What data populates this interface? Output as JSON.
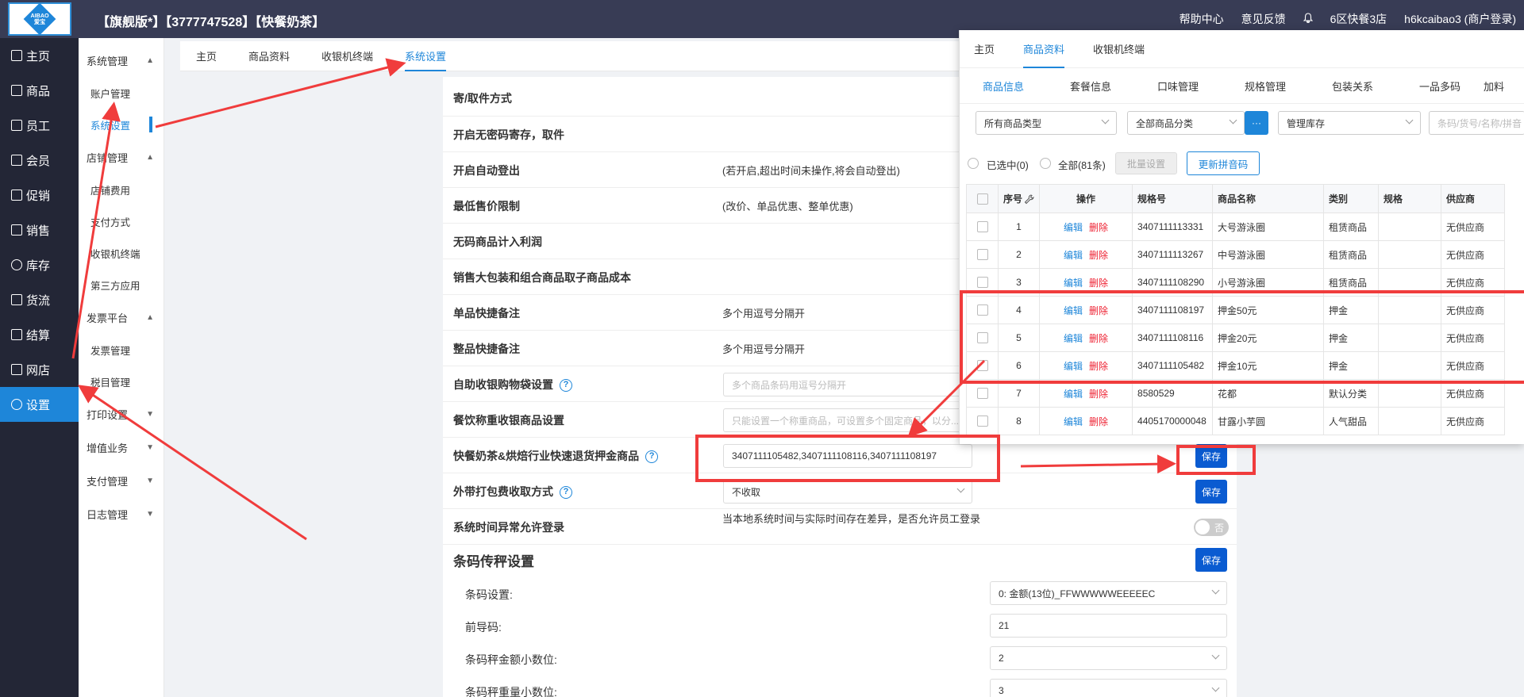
{
  "logo": {
    "text_top": "AIBAO",
    "text_bottom": "爱宝"
  },
  "header": {
    "title": "【旗舰版*】【3777747528】【快餐奶茶】",
    "help": "帮助中心",
    "feedback": "意见反馈",
    "store": "6区快餐3店",
    "user": "h6kcaibao3 (商户登录)"
  },
  "leftnav": {
    "items": [
      {
        "label": "主页",
        "icon": "home-icon"
      },
      {
        "label": "商品",
        "icon": "goods-icon"
      },
      {
        "label": "员工",
        "icon": "staff-icon"
      },
      {
        "label": "会员",
        "icon": "member-icon"
      },
      {
        "label": "促销",
        "icon": "promo-icon"
      },
      {
        "label": "销售",
        "icon": "sales-icon"
      },
      {
        "label": "库存",
        "icon": "inventory-icon"
      },
      {
        "label": "货流",
        "icon": "logistics-icon"
      },
      {
        "label": "结算",
        "icon": "settle-icon"
      },
      {
        "label": "网店",
        "icon": "shop-icon"
      },
      {
        "label": "设置",
        "icon": "gear-icon"
      }
    ]
  },
  "subnav": {
    "g1": "系统管理",
    "g1_items": [
      "账户管理",
      "系统设置"
    ],
    "g2": "店铺管理",
    "g2_items": [
      "店铺费用",
      "支付方式",
      "收银机终端",
      "第三方应用"
    ],
    "g3": "发票平台",
    "g3_items": [
      "发票管理",
      "税目管理"
    ],
    "g4": "打印设置",
    "g5": "增值业务",
    "g6": "支付管理",
    "g7": "日志管理"
  },
  "tabs": {
    "home": "主页",
    "goods": "商品资料",
    "pos": "收银机终端",
    "settings": "系统设置"
  },
  "settings": {
    "r1": "寄/取件方式",
    "r2": "开启无密码寄存，取件",
    "r3": "开启自动登出",
    "r3_desc": "(若开启,超出时间未操作,将会自动登出)",
    "r4": "最低售价限制",
    "r4_desc": "(改价、单品优惠、整单优惠)",
    "r5": "无码商品计入利润",
    "r6": "销售大包装和组合商品取子商品成本",
    "r7": "单品快捷备注",
    "r7_desc": "多个用逗号分隔开",
    "r8": "整品快捷备注",
    "r8_desc": "多个用逗号分隔开",
    "r9": "自助收银购物袋设置",
    "r9_ph": "多个商品条码用逗号分隔开",
    "r10": "餐饮称重收银商品设置",
    "r10_ph": "只能设置一个称重商品，可设置多个固定商品，以分...",
    "r11": "快餐奶茶&烘焙行业快速退货押金商品",
    "r11_val": "3407111105482,3407111108116,3407111108197",
    "r12": "外带打包费收取方式",
    "r12_val": "不收取",
    "r13": "系统时间异常允许登录",
    "r13_desc": "当本地系统时间与实际时间存在差异，是否允许员工登录",
    "toggle_off": "否",
    "save": "保存",
    "barcode_title": "条码传秤设置",
    "bc1": "条码设置:",
    "bc1_val": "0: 金额(13位)_FFWWWWWEEEEEC",
    "bc2": "前导码:",
    "bc2_val": "21",
    "bc3": "条码秤金额小数位:",
    "bc3_val": "2",
    "bc4": "条码秤重量小数位:",
    "bc4_val": "3"
  },
  "overlay": {
    "tabs": [
      "主页",
      "商品资料",
      "收银机终端"
    ],
    "subtabs": [
      "商品信息",
      "套餐信息",
      "口味管理",
      "规格管理",
      "包装关系",
      "一品多码",
      "加料"
    ],
    "filter_type": "所有商品类型",
    "filter_cat": "全部商品分类",
    "more": "···",
    "filter_stock": "管理库存",
    "search_ph": "条码/货号/名称/拼音",
    "selected": "已选中(0)",
    "all": "全部(81条)",
    "batch": "批量设置",
    "update_py": "更新拼音码",
    "columns": [
      "序号",
      "操作",
      "规格号",
      "商品名称",
      "类别",
      "规格",
      "供应商"
    ],
    "edit": "编辑",
    "delete": "删除",
    "rows": [
      {
        "no": "1",
        "code": "3407111113331",
        "name": "大号游泳圈",
        "cat": "租赁商品",
        "spec": "",
        "supplier": "无供应商"
      },
      {
        "no": "2",
        "code": "3407111113267",
        "name": "中号游泳圈",
        "cat": "租赁商品",
        "spec": "",
        "supplier": "无供应商"
      },
      {
        "no": "3",
        "code": "3407111108290",
        "name": "小号游泳圈",
        "cat": "租赁商品",
        "spec": "",
        "supplier": "无供应商"
      },
      {
        "no": "4",
        "code": "3407111108197",
        "name": "押金50元",
        "cat": "押金",
        "spec": "",
        "supplier": "无供应商"
      },
      {
        "no": "5",
        "code": "3407111108116",
        "name": "押金20元",
        "cat": "押金",
        "spec": "",
        "supplier": "无供应商"
      },
      {
        "no": "6",
        "code": "3407111105482",
        "name": "押金10元",
        "cat": "押金",
        "spec": "",
        "supplier": "无供应商"
      },
      {
        "no": "7",
        "code": "8580529",
        "name": "花都",
        "cat": "默认分类",
        "spec": "",
        "supplier": "无供应商"
      },
      {
        "no": "8",
        "code": "4405170000048",
        "name": "甘露小芋圆",
        "cat": "人气甜品",
        "spec": "",
        "supplier": "无供应商"
      }
    ]
  },
  "colors": {
    "topbar": "#383c55",
    "leftnav": "#232636",
    "accent": "#1e86d9",
    "save": "#0a5bd1",
    "annotation": "#f03c3c"
  }
}
